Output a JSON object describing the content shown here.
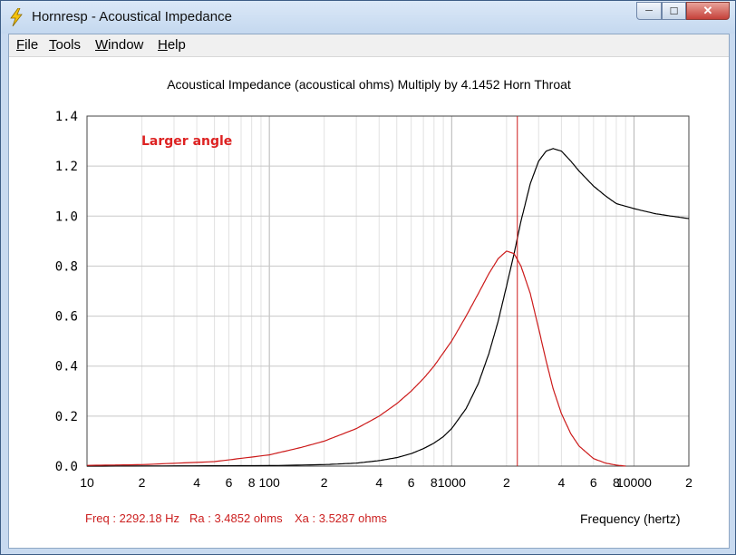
{
  "window": {
    "title": "Hornresp - Acoustical Impedance",
    "buttons": {
      "minimize": "─",
      "maximize": "☐",
      "close": "✕"
    }
  },
  "menu": {
    "items": [
      {
        "key": "F",
        "rest": "ile"
      },
      {
        "key": "T",
        "rest": "ools"
      },
      {
        "key": "W",
        "rest": "indow"
      },
      {
        "key": "H",
        "rest": "elp"
      }
    ]
  },
  "plot": {
    "title": "Acoustical Impedance (acoustical ohms)   Multiply by 4.1452   Horn Throat",
    "annotation": "Larger angle",
    "x_axis_title": "Frequency (hertz)"
  },
  "status": {
    "freq": "Freq : 2292.18 Hz",
    "ra": "Ra : 3.4852 ohms",
    "xa": "Xa : 3.5287 ohms"
  },
  "colors": {
    "resistance": "#000000",
    "reactance": "#cc1a1a",
    "cursor": "#cc1a1a",
    "annotation": "#dd2222"
  },
  "chart_data": {
    "type": "line",
    "x_scale": "log",
    "xlim": [
      10,
      20000
    ],
    "ylim": [
      0,
      1.4
    ],
    "y_ticks": [
      "0.0",
      "0.2",
      "0.4",
      "0.6",
      "0.8",
      "1.0",
      "1.2",
      "1.4"
    ],
    "x_ticks": [
      {
        "v": 10,
        "label": "10"
      },
      {
        "v": 20,
        "label": "2"
      },
      {
        "v": 40,
        "label": "4"
      },
      {
        "v": 60,
        "label": "6"
      },
      {
        "v": 80,
        "label": "8"
      },
      {
        "v": 100,
        "label": "100"
      },
      {
        "v": 200,
        "label": "2"
      },
      {
        "v": 400,
        "label": "4"
      },
      {
        "v": 600,
        "label": "6"
      },
      {
        "v": 800,
        "label": "8"
      },
      {
        "v": 1000,
        "label": "1000"
      },
      {
        "v": 2000,
        "label": "2"
      },
      {
        "v": 4000,
        "label": "4"
      },
      {
        "v": 6000,
        "label": "6"
      },
      {
        "v": 8000,
        "label": "8"
      },
      {
        "v": 10000,
        "label": "10000"
      },
      {
        "v": 20000,
        "label": "2"
      }
    ],
    "cursor_x": 2292.18,
    "series": [
      {
        "color": "#000000",
        "x": [
          10,
          100,
          200,
          300,
          400,
          500,
          600,
          700,
          800,
          900,
          1000,
          1200,
          1400,
          1600,
          1800,
          2000,
          2200,
          2400,
          2700,
          3000,
          3300,
          3600,
          4000,
          4500,
          5000,
          6000,
          7000,
          8000,
          10000,
          13000,
          16000,
          20000
        ],
        "y": [
          0,
          0.002,
          0.006,
          0.012,
          0.022,
          0.034,
          0.05,
          0.07,
          0.092,
          0.118,
          0.15,
          0.23,
          0.33,
          0.45,
          0.58,
          0.72,
          0.85,
          0.98,
          1.13,
          1.22,
          1.26,
          1.27,
          1.26,
          1.22,
          1.18,
          1.12,
          1.08,
          1.05,
          1.03,
          1.01,
          1.0,
          0.99
        ]
      },
      {
        "color": "#cc1a1a",
        "x": [
          10,
          20,
          50,
          100,
          150,
          200,
          300,
          400,
          500,
          600,
          700,
          800,
          1000,
          1200,
          1400,
          1600,
          1800,
          2000,
          2200,
          2400,
          2700,
          3000,
          3300,
          3600,
          4000,
          4500,
          5000,
          6000,
          7000,
          8000,
          9000
        ],
        "y": [
          0.003,
          0.006,
          0.018,
          0.045,
          0.075,
          0.1,
          0.15,
          0.2,
          0.25,
          0.3,
          0.35,
          0.4,
          0.5,
          0.6,
          0.69,
          0.77,
          0.83,
          0.86,
          0.85,
          0.8,
          0.69,
          0.55,
          0.42,
          0.31,
          0.21,
          0.13,
          0.08,
          0.03,
          0.012,
          0.004,
          0.0
        ]
      }
    ]
  }
}
